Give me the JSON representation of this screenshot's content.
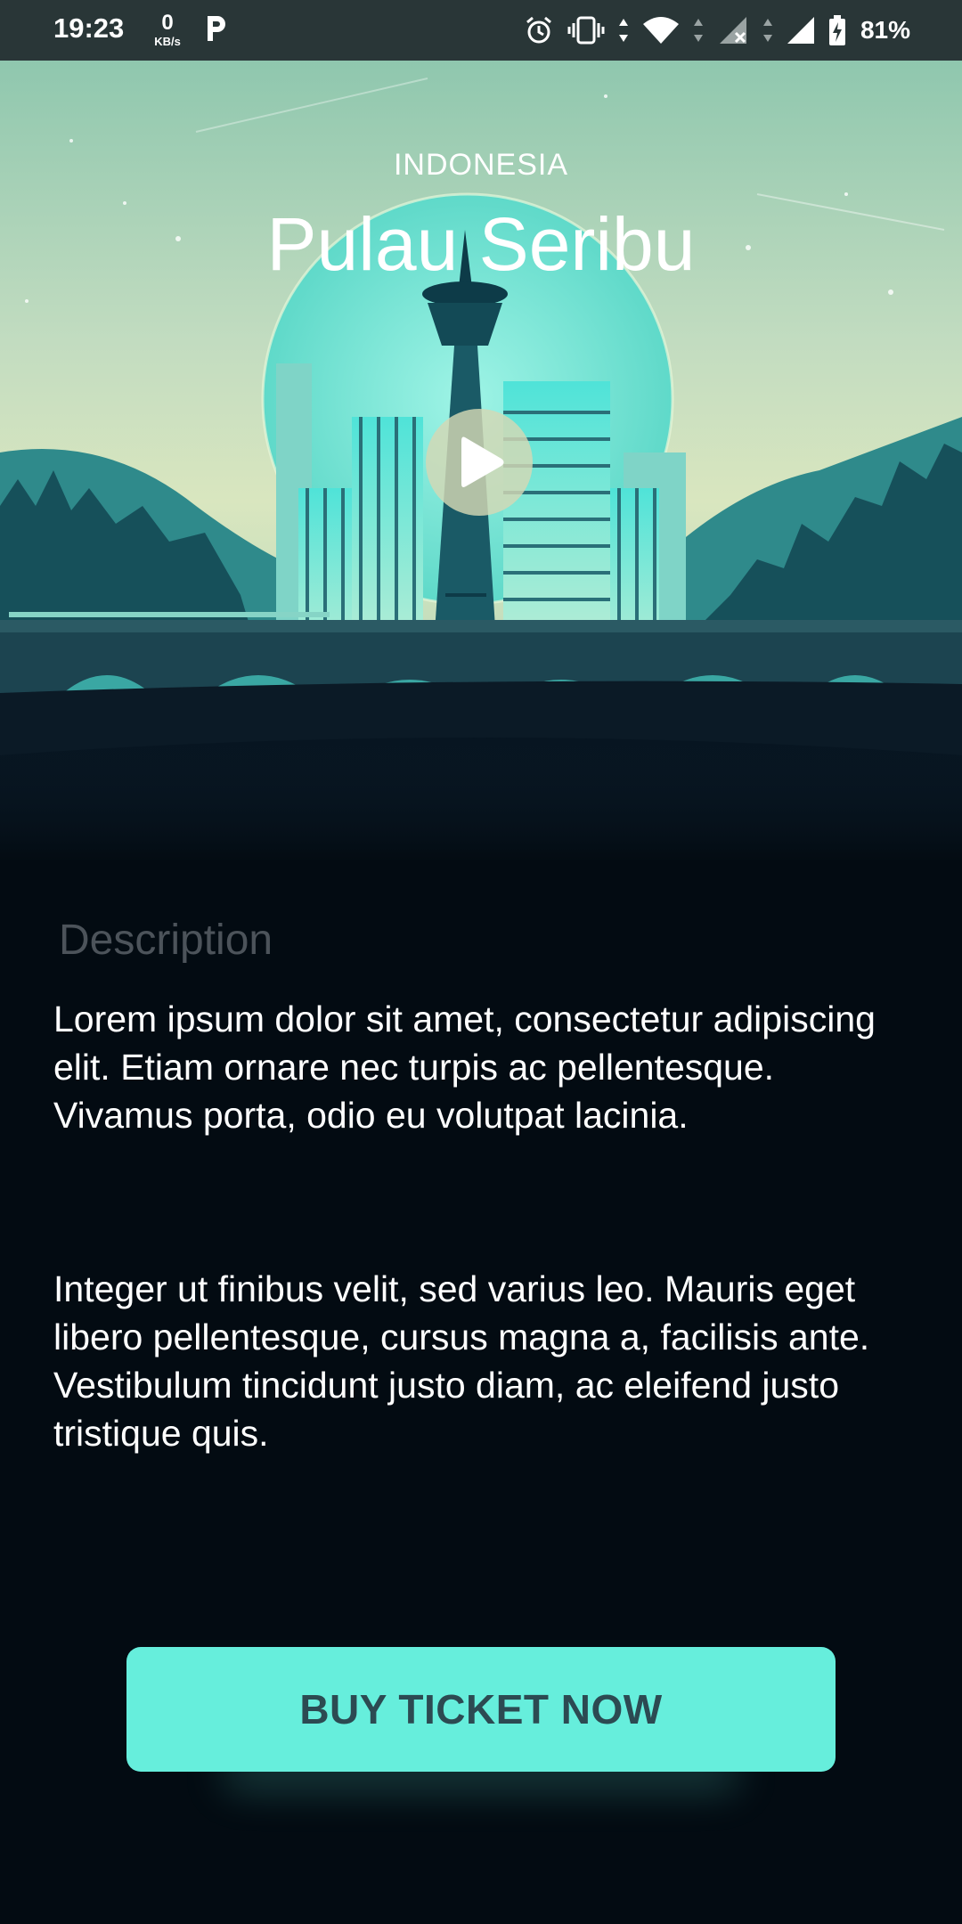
{
  "status_bar": {
    "time": "19:23",
    "net_speed_value": "0",
    "net_speed_unit": "KB/s",
    "battery_percent": "81%",
    "icons": [
      "parking-app-icon",
      "alarm-icon",
      "vibrate-icon",
      "wifi-icon",
      "signal-no-sim-icon",
      "signal-icon",
      "battery-charging-icon"
    ]
  },
  "hero": {
    "subtitle": "INDONESIA",
    "title": "Pulau Seribu",
    "play_icon": "play-icon",
    "colors": {
      "sky_top": "#8fc7ae",
      "moon": "#6fe0cf",
      "city": "#4fe3d8",
      "ground": "#071521"
    }
  },
  "content": {
    "heading": "Description",
    "paragraphs": [
      "Lorem ipsum dolor sit amet, consectetur adipiscing elit. Etiam ornare nec turpis ac pellentesque. Vivamus porta, odio eu volutpat lacinia.",
      "Integer ut finibus velit, sed varius leo. Mauris eget libero pellentesque, cursus magna a, facilisis ante. Vestibulum tincidunt justo diam, ac eleifend justo tristique quis."
    ]
  },
  "cta": {
    "label": "BUY TICKET NOW",
    "color": "#66eedc"
  }
}
